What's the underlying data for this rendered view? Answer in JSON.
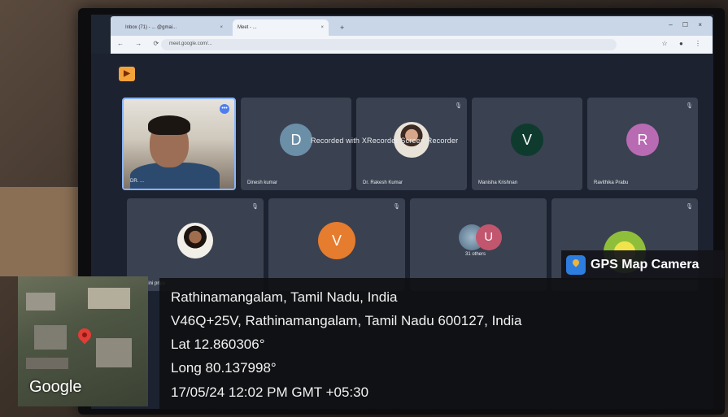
{
  "browser": {
    "tabs": [
      {
        "label": "Inbox (71) - ... @gmai...",
        "close": "×"
      },
      {
        "label": "Meet - ... ",
        "close": "×"
      }
    ],
    "new_tab": "+",
    "window_controls": "– ☐ ×",
    "nav": "← → ⟳",
    "url": "meet.google.com/...",
    "addr_icons": "☆ ●  ⋮"
  },
  "meet": {
    "logo_glyph": "▶",
    "recorded_banner": "Recorded with XRecorder Screen Recorder",
    "tiles": [
      {
        "name": "DR. ...",
        "kind": "camera"
      },
      {
        "name": "Dinesh kumar",
        "avatar": "D",
        "color": "#6c8fa8"
      },
      {
        "name": "Dr. Rakesh Kumar",
        "kind": "photo"
      },
      {
        "name": "Manisha Krishnan",
        "avatar": "V",
        "color": "#0f3b2e"
      },
      {
        "name": "Ravithika Prabu",
        "avatar": "R",
        "color": "#b86bb3"
      },
      {
        "name": "dharshini priya",
        "kind": "photo"
      },
      {
        "name": "",
        "avatar": "V",
        "color": "#e67c2e"
      },
      {
        "name": "31 others",
        "kind": "others",
        "avatar": "U"
      },
      {
        "name": "",
        "kind": "green"
      }
    ]
  },
  "gps": {
    "badge": "GPS Map Camera",
    "place": "Rathinamangalam, Tamil Nadu, India",
    "address": "V46Q+25V, Rathinamangalam, Tamil Nadu 600127, India",
    "lat": "Lat 12.860306°",
    "long": "Long 80.137998°",
    "datetime": "17/05/24 12:02 PM GMT +05:30",
    "map_label": "Google"
  }
}
